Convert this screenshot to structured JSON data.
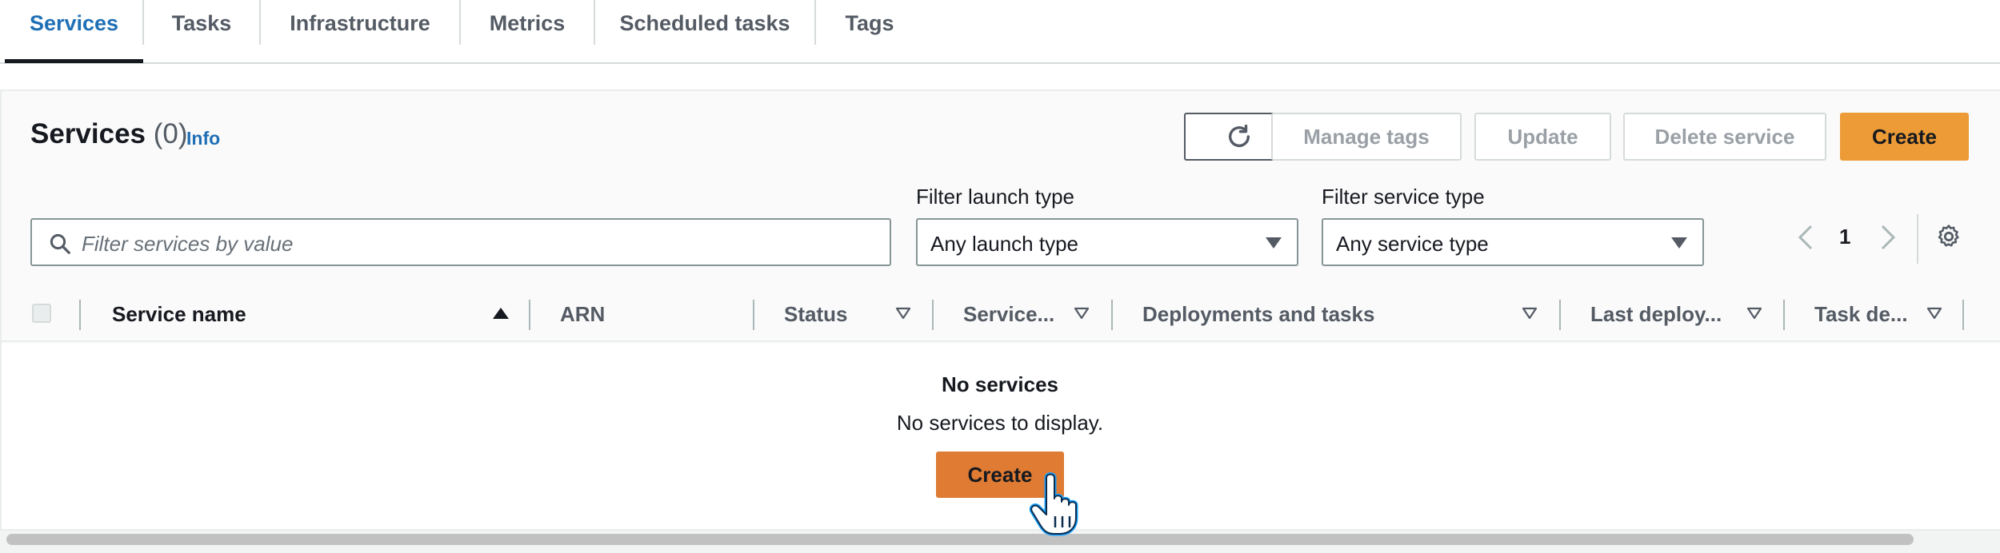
{
  "tabs": [
    {
      "label": "Services",
      "active": true
    },
    {
      "label": "Tasks"
    },
    {
      "label": "Infrastructure"
    },
    {
      "label": "Metrics"
    },
    {
      "label": "Scheduled tasks"
    },
    {
      "label": "Tags"
    }
  ],
  "panel": {
    "title": "Services",
    "count": "(0)",
    "info": "Info"
  },
  "toolbar": {
    "refresh_icon": "refresh-icon",
    "manage_tags": "Manage tags",
    "update": "Update",
    "delete_service": "Delete service",
    "create": "Create"
  },
  "filters": {
    "search_placeholder": "Filter services by value",
    "launch_type_label": "Filter launch type",
    "launch_type_value": "Any launch type",
    "service_type_label": "Filter service type",
    "service_type_value": "Any service type"
  },
  "pagination": {
    "page": "1"
  },
  "table": {
    "columns": [
      "Service name",
      "ARN",
      "Status",
      "Service...",
      "Deployments and tasks",
      "Last deploy...",
      "Task de..."
    ]
  },
  "empty_state": {
    "title": "No services",
    "text": "No services to display.",
    "create": "Create"
  },
  "colors": {
    "accent": "#1f6fb5",
    "primary_button": "#ec9b36",
    "create_button_hover": "#df7b33"
  }
}
